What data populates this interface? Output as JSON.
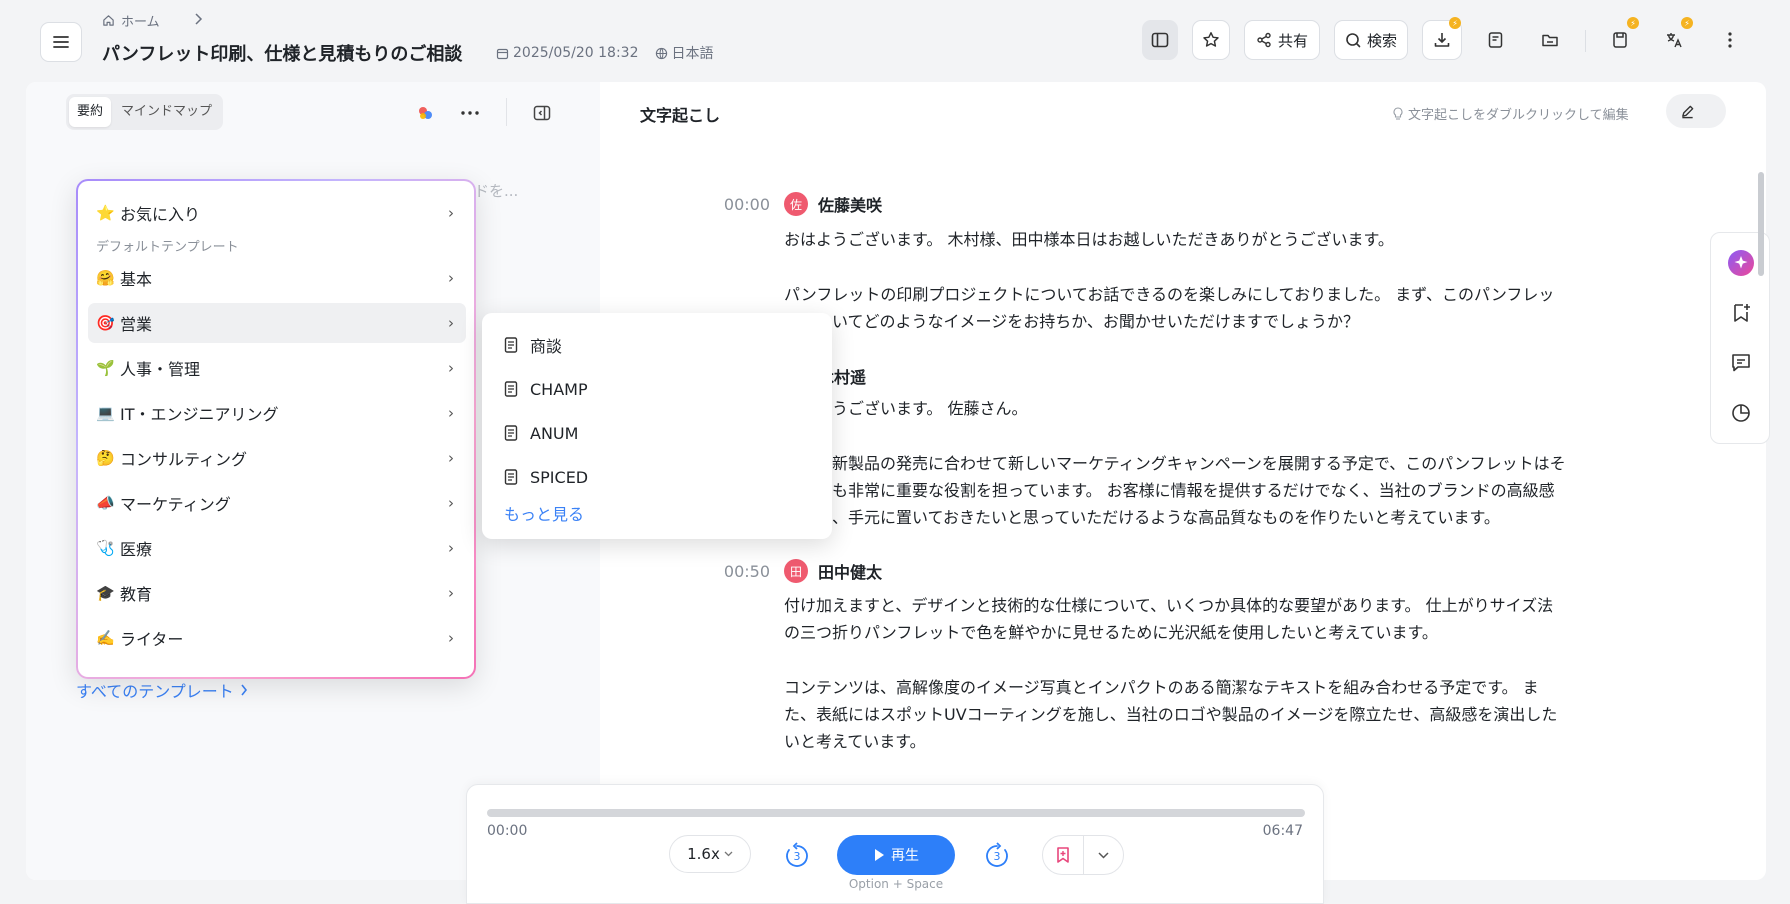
{
  "breadcrumb": {
    "home": "ホーム"
  },
  "document": {
    "title": "パンフレット印刷、仕様と見積もりのご相談",
    "datetime": "2025/05/20 18:32",
    "language": "日本語"
  },
  "toolbar": {
    "share_label": "共有",
    "search_label": "検索"
  },
  "colors": {
    "accent": "#2d7ff9",
    "badge": "#f5b321",
    "avatar": "#ef5a6f"
  },
  "left_panel": {
    "tabs": [
      {
        "label": "要約",
        "active": true
      },
      {
        "label": "マインドマップ",
        "active": false
      }
    ],
    "background_hint": "ドを...",
    "all_templates_label": "すべてのテンプレート"
  },
  "template_menu": {
    "favorites": {
      "emoji": "⭐",
      "label": "お気に入り"
    },
    "section_label": "デフォルトテンプレート",
    "items": [
      {
        "emoji": "🤗",
        "label": "基本"
      },
      {
        "emoji": "🎯",
        "label": "営業",
        "highlighted": true
      },
      {
        "emoji": "🌱",
        "label": "人事・管理"
      },
      {
        "emoji": "💻",
        "label": "IT・エンジニアリング"
      },
      {
        "emoji": "🤔",
        "label": "コンサルティング"
      },
      {
        "emoji": "📣",
        "label": "マーケティング"
      },
      {
        "emoji": "🩺",
        "label": "医療"
      },
      {
        "emoji": "🎓",
        "label": "教育"
      },
      {
        "emoji": "✍️",
        "label": "ライター"
      }
    ]
  },
  "submenu": {
    "items": [
      "商談",
      "CHAMP",
      "ANUM",
      "SPICED"
    ],
    "more_label": "もっと見る"
  },
  "transcript": {
    "title": "文字起こし",
    "edit_hint": "文字起こしをダブルクリックして編集",
    "entries": [
      {
        "time": "00:00",
        "avatar": "佐",
        "speaker": "佐藤美咲",
        "paragraphs": [
          "おはようございます。 木村様、田中様本日はお越しいただきありがとうございます。",
          "パンフレットの印刷プロジェクトについてお話できるのを楽しみにしておりました。 まず、このパンフレッ トについてどのようなイメージをお持ちか、お聞かせいただけますでしょうか？"
        ]
      },
      {
        "speaker": "木村遥",
        "paragraphs": [
          "おはようございます。 佐藤さん。",
          "弊社は新製品の発売に合わせて新しいマーケティングキャンペーンを展開する予定で、このパンフレットはそ の中でも非常に重要な役割を担っています。 お客様に情報を提供するだけでなく、当社のブランドの高級感 を伝え、手元に置いておきたいと思っていただけるような高品質なものを作りたいと考えています。"
        ]
      },
      {
        "time": "00:50",
        "avatar": "田",
        "speaker": "田中健太",
        "paragraphs": [
          "付け加えますと、デザインと技術的な仕様について、いくつか具体的な要望があります。 仕上がりサイズ法 の三つ折りパンフレットで色を鮮やかに見せるために光沢紙を使用したいと考えています。",
          "コンテンツは、高解像度のイメージ写真とインパクトのある簡潔なテキストを組み合わせる予定です。 ま た、表紙にはスポットUVコーティングを施し、当社のロゴや製品のイメージを際立たせ、高級感を演出した いと考えています。"
        ]
      }
    ]
  },
  "player": {
    "current_time": "00:00",
    "duration": "06:47",
    "progress": 0,
    "speed": "1.6x",
    "skip_back": "3",
    "skip_forward": "3",
    "play_label": "再生",
    "shortcut_hint": "Option + Space"
  }
}
